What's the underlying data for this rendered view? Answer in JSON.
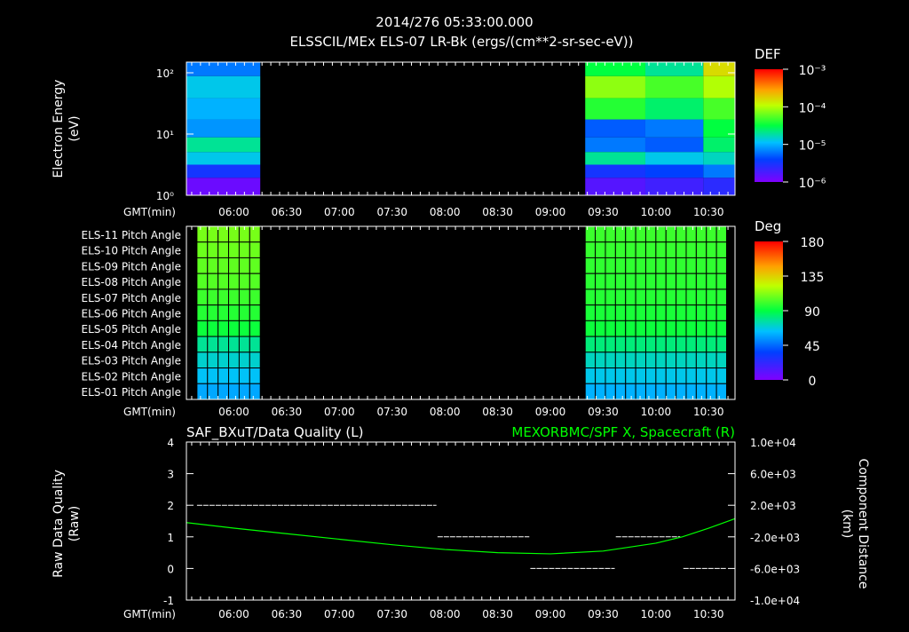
{
  "header": {
    "timestamp": "2014/276 05:33:00.000",
    "title": "ELSSCIL/MEx ELS-07 LR-Bk  (ergs/(cm**2-sr-sec-eV))"
  },
  "chart_data": [
    {
      "type": "heatmap",
      "name": "energy-spectrogram",
      "ylabel": "Electron Energy",
      "yunits": "(eV)",
      "yscale": "log",
      "ylim": [
        1,
        150
      ],
      "ytick_labels": [
        "10⁰",
        "10¹",
        "10²"
      ],
      "ytick_values": [
        1,
        10,
        100
      ],
      "xlabel": "GMT(min)",
      "xlim_hours": [
        5.55,
        10.75
      ],
      "xtick_labels": [
        "06:00",
        "06:30",
        "07:00",
        "07:30",
        "08:00",
        "08:30",
        "09:00",
        "09:30",
        "10:00",
        "10:30"
      ],
      "colorbar": {
        "label": "DEF",
        "scale": "log",
        "range": [
          1e-06,
          0.001
        ],
        "tick_labels": [
          "10⁻³",
          "10⁻⁴",
          "10⁻⁵",
          "10⁻⁶"
        ]
      },
      "energy_bands": [
        1.5,
        2.5,
        4,
        6.5,
        12,
        25,
        60,
        130
      ],
      "segments": [
        {
          "start": 5.55,
          "end": 6.25,
          "log_def": [
            -5.9,
            -5.5,
            -4.9,
            -4.7,
            -5.1,
            -5.0,
            -4.9,
            -5.2
          ]
        },
        {
          "start": 9.33,
          "end": 9.9,
          "log_def": [
            -5.8,
            -5.5,
            -4.7,
            -5.2,
            -5.3,
            -4.4,
            -4.1,
            -4.5
          ]
        },
        {
          "start": 9.9,
          "end": 10.45,
          "log_def": [
            -5.7,
            -5.4,
            -4.9,
            -5.3,
            -5.2,
            -4.6,
            -4.3,
            -4.7
          ]
        },
        {
          "start": 10.45,
          "end": 10.75,
          "log_def": [
            -5.6,
            -5.2,
            -4.8,
            -4.6,
            -4.5,
            -4.3,
            -4.0,
            -3.8
          ]
        }
      ]
    },
    {
      "type": "heatmap",
      "name": "pitch-angle",
      "xlabel": "GMT(min)",
      "rows": [
        "ELS-11 Pitch Angle",
        "ELS-10 Pitch Angle",
        "ELS-09 Pitch Angle",
        "ELS-08 Pitch Angle",
        "ELS-07 Pitch Angle",
        "ELS-06 Pitch Angle",
        "ELS-05 Pitch Angle",
        "ELS-04 Pitch Angle",
        "ELS-03 Pitch Angle",
        "ELS-02 Pitch Angle",
        "ELS-01 Pitch Angle"
      ],
      "colorbar": {
        "label": "Deg",
        "range": [
          0,
          180
        ],
        "tick_labels": [
          "180",
          "135",
          "90",
          "45",
          "0"
        ]
      },
      "segments": [
        {
          "start": 5.65,
          "end": 6.25,
          "columns": 6,
          "values": [
            110,
            108,
            106,
            104,
            100,
            96,
            92,
            78,
            70,
            64,
            58
          ]
        },
        {
          "start": 9.33,
          "end": 10.67,
          "columns": 14,
          "values": [
            100,
            99,
            98,
            97,
            96,
            94,
            92,
            82,
            72,
            66,
            60
          ]
        }
      ]
    },
    {
      "type": "line",
      "name": "data-quality",
      "title_left": "SAF_BXuT/Data Quality (L)",
      "title_right": "MEXORBMC/SPF X, Spacecraft (R)",
      "ylabel": "Raw Data Quality",
      "yunits": "(Raw)",
      "ylim": [
        -1,
        4
      ],
      "ytick_labels": [
        "4",
        "3",
        "2",
        "1",
        "0",
        "-1"
      ],
      "y2label": "Component Distance",
      "y2units": "(km)",
      "y2lim": [
        -10000,
        10000
      ],
      "y2tick_labels": [
        "1.0e+04",
        "6.0e+03",
        "2.0e+03",
        "-2.0e+03",
        "-6.0e+03",
        "-1.0e+04"
      ],
      "xlabel": "GMT(min)",
      "quality_segments": [
        {
          "start": 5.65,
          "end": 7.92,
          "value": 2
        },
        {
          "start": 7.93,
          "end": 8.8,
          "value": 1
        },
        {
          "start": 8.81,
          "end": 9.61,
          "value": 0
        },
        {
          "start": 9.62,
          "end": 10.23,
          "value": 1
        },
        {
          "start": 10.26,
          "end": 10.67,
          "value": 0
        }
      ],
      "spf_x": {
        "x_hours": [
          5.55,
          6.0,
          6.5,
          7.0,
          7.5,
          8.0,
          8.5,
          9.0,
          9.5,
          10.0,
          10.25,
          10.5,
          10.75
        ],
        "y_km": [
          -200,
          -900,
          -1600,
          -2300,
          -3000,
          -3600,
          -4000,
          -4150,
          -3800,
          -2800,
          -2000,
          -900,
          300
        ]
      },
      "colors": {
        "quality": "#ffffff",
        "spf": "#00ff00"
      }
    }
  ]
}
